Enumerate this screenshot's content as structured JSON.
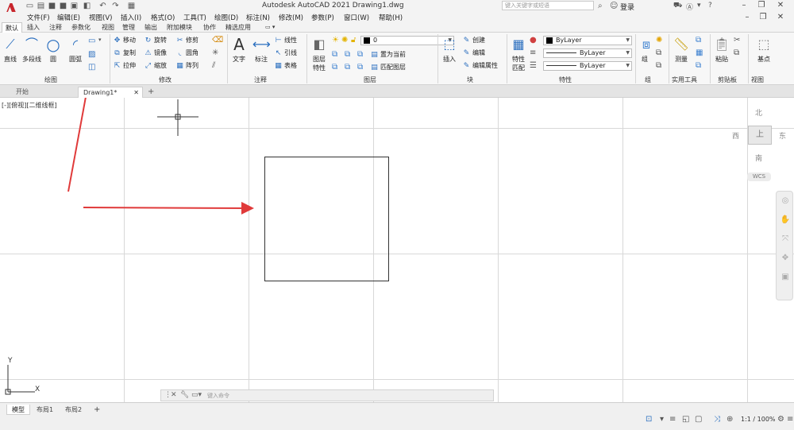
{
  "app": {
    "logo_letter": "A",
    "title": "Autodesk AutoCAD 2021    Drawing1.dwg",
    "search_placeholder": "键入关键字或短语",
    "sign_in": "登录",
    "brand_color": "#c8252c"
  },
  "menu": [
    "文件(F)",
    "编辑(E)",
    "视图(V)",
    "插入(I)",
    "格式(O)",
    "工具(T)",
    "绘图(D)",
    "标注(N)",
    "修改(M)",
    "参数(P)",
    "窗口(W)",
    "帮助(H)"
  ],
  "ribbon_tabs": [
    "默认",
    "插入",
    "注释",
    "参数化",
    "视图",
    "管理",
    "输出",
    "附加模块",
    "协作",
    "精选应用"
  ],
  "ribbon": {
    "draw": {
      "title": "绘图",
      "line": "直线",
      "polyline": "多段线",
      "circle": "圆",
      "arc": "圆弧"
    },
    "modify": {
      "title": "修改",
      "move": "移动",
      "rotate": "旋转",
      "trim": "修剪",
      "copy": "复制",
      "mirror": "镜像",
      "fillet": "圆角",
      "stretch": "拉伸",
      "scale": "缩放",
      "array": "阵列"
    },
    "annotation": {
      "title": "注释",
      "text": "文字",
      "dimension": "标注",
      "linear": "线性",
      "leader": "引线",
      "table": "表格"
    },
    "layers": {
      "title": "图层",
      "layer_properties_line1": "图层",
      "layer_properties_line2": "特性",
      "current_layer": "0",
      "make_current": "置为当前",
      "match_layer": "匹配图层"
    },
    "block": {
      "title": "块",
      "insert": "插入",
      "create": "创建",
      "edit": "编辑",
      "edit_attributes": "编辑属性"
    },
    "properties": {
      "title": "特性",
      "match_line1": "特性",
      "match_line2": "匹配",
      "color": "ByLayer",
      "linetype": "ByLayer",
      "lineweight": "ByLayer"
    },
    "groups": {
      "title": "组",
      "group": "组"
    },
    "utilities": {
      "title": "实用工具",
      "measure": "测量"
    },
    "clipboard": {
      "title": "剪贴板",
      "paste": "粘贴"
    },
    "view": {
      "title": "视图",
      "base": "基点"
    }
  },
  "doc_tabs": [
    "开始",
    "Drawing1*"
  ],
  "viewport": {
    "label": "[-][俯视][二维线框]",
    "viewcube": {
      "north": "北",
      "south": "南",
      "west": "西",
      "east": "东",
      "top": "上",
      "wcs": "WCS"
    },
    "ucs_x": "X",
    "ucs_y": "Y",
    "command_placeholder": "键入命令"
  },
  "layout_tabs": [
    "模型",
    "布局1",
    "布局2"
  ],
  "status": {
    "scale": "1:1 / 100%"
  },
  "annotation_arrow_color": "#e03a3a"
}
